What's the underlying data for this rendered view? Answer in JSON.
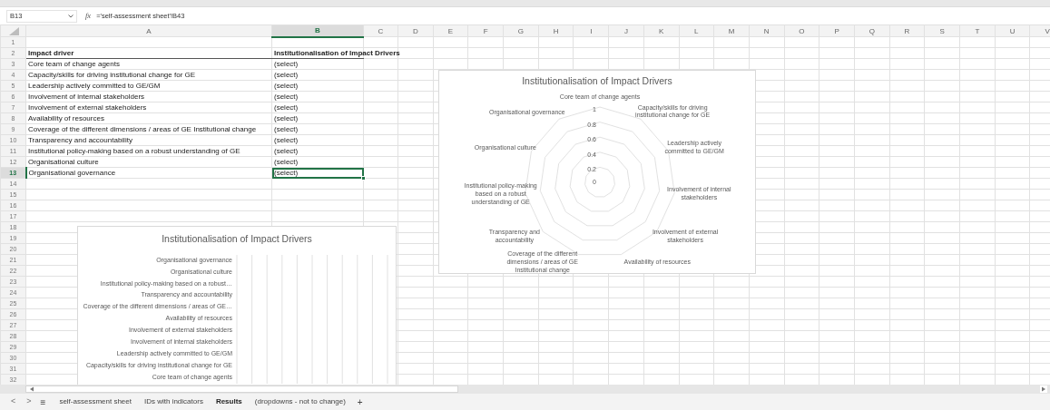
{
  "formula_bar": {
    "name_box": "B13",
    "function_label": "fx",
    "formula": "='self-assessment sheet'!B43"
  },
  "columns": [
    {
      "label": "A",
      "selected": false
    },
    {
      "label": "B",
      "selected": true
    },
    {
      "label": "C",
      "selected": false
    },
    {
      "label": "D",
      "selected": false
    },
    {
      "label": "E",
      "selected": false
    },
    {
      "label": "F",
      "selected": false
    },
    {
      "label": "G",
      "selected": false
    },
    {
      "label": "H",
      "selected": false
    },
    {
      "label": "I",
      "selected": false
    },
    {
      "label": "J",
      "selected": false
    },
    {
      "label": "K",
      "selected": false
    },
    {
      "label": "L",
      "selected": false
    },
    {
      "label": "M",
      "selected": false
    },
    {
      "label": "N",
      "selected": false
    },
    {
      "label": "O",
      "selected": false
    },
    {
      "label": "P",
      "selected": false
    },
    {
      "label": "Q",
      "selected": false
    },
    {
      "label": "R",
      "selected": false
    },
    {
      "label": "S",
      "selected": false
    },
    {
      "label": "T",
      "selected": false
    },
    {
      "label": "U",
      "selected": false
    },
    {
      "label": "V",
      "selected": false
    }
  ],
  "rows": [
    {
      "number": "1",
      "selected": false
    },
    {
      "number": "2",
      "selected": false,
      "kind": "header",
      "cells": [
        "Impact driver",
        "Institutionalisation of Impact Drivers"
      ]
    },
    {
      "number": "3",
      "selected": false,
      "kind": "data",
      "cells": [
        "Core team of change agents",
        "(select)"
      ]
    },
    {
      "number": "4",
      "selected": false,
      "kind": "data",
      "cells": [
        "Capacity/skills for driving institutional change for GE",
        "(select)"
      ]
    },
    {
      "number": "5",
      "selected": false,
      "kind": "data",
      "cells": [
        "Leadership actively committed to GE/GM",
        "(select)"
      ]
    },
    {
      "number": "6",
      "selected": false,
      "kind": "data",
      "cells": [
        "Involvement of internal stakeholders",
        "(select)"
      ]
    },
    {
      "number": "7",
      "selected": false,
      "kind": "data",
      "cells": [
        "Involvement of external stakeholders",
        "(select)"
      ]
    },
    {
      "number": "8",
      "selected": false,
      "kind": "data",
      "cells": [
        "Availability of resources",
        "(select)"
      ]
    },
    {
      "number": "9",
      "selected": false,
      "kind": "data",
      "cells": [
        "Coverage of the different dimensions / areas of GE Institutional change",
        "(select)"
      ]
    },
    {
      "number": "10",
      "selected": false,
      "kind": "data",
      "cells": [
        "Transparency and accountability",
        "(select)"
      ]
    },
    {
      "number": "11",
      "selected": false,
      "kind": "data",
      "cells": [
        "Institutional policy-making based on a robust understanding of GE",
        "(select)"
      ]
    },
    {
      "number": "12",
      "selected": false,
      "kind": "data",
      "cells": [
        "Organisational culture",
        "(select)"
      ]
    },
    {
      "number": "13",
      "selected": true,
      "kind": "data",
      "cells": [
        "Organisational governance",
        "(select)"
      ]
    },
    {
      "number": "14",
      "selected": false
    },
    {
      "number": "15",
      "selected": false
    },
    {
      "number": "16",
      "selected": false
    },
    {
      "number": "17",
      "selected": false
    },
    {
      "number": "18",
      "selected": false
    },
    {
      "number": "19",
      "selected": false
    },
    {
      "number": "20",
      "selected": false
    },
    {
      "number": "21",
      "selected": false
    },
    {
      "number": "22",
      "selected": false
    },
    {
      "number": "23",
      "selected": false
    },
    {
      "number": "24",
      "selected": false
    },
    {
      "number": "25",
      "selected": false
    },
    {
      "number": "26",
      "selected": false
    },
    {
      "number": "27",
      "selected": false
    },
    {
      "number": "28",
      "selected": false
    },
    {
      "number": "29",
      "selected": false
    },
    {
      "number": "30",
      "selected": false
    },
    {
      "number": "31",
      "selected": false
    },
    {
      "number": "32",
      "selected": false
    }
  ],
  "charts": [
    {
      "kind": "radar",
      "title": "Institutionalisation of Impact Drivers",
      "axis_labels": [
        "Core team of change agents",
        "Organisational governance",
        "Capacity/skills for driving institutional change for GE",
        "Organisational culture",
        "Leadership actively committed to GE/GM",
        "Institutional policy-making based on a robust understanding of GE",
        "Involvement of internal stakeholders",
        "Transparency and accountability",
        "Involvement of external stakeholders",
        "Coverage of the different dimensions / areas of GE Institutional change",
        "Availability of resources"
      ],
      "scale_labels": [
        "1",
        "0.8",
        "0.6",
        "0.4",
        "0.2",
        "0"
      ]
    },
    {
      "kind": "bar",
      "chart_data": {
        "type": "other",
        "title": "Institutionalisation of Impact Drivers",
        "categories": [
          "Organisational governance",
          "Organisational culture",
          "Institutional policy-making based on a robust…",
          "Transparency and accountability",
          "Coverage of the different dimensions / areas of GE…",
          "Availability of resources",
          "Involvement of external stakeholders",
          "Involvement of internal stakeholders",
          "Leadership actively committed to GE/GM",
          "Capacity/skills for driving institutional change for GE",
          "Core team of change agents"
        ]
      }
    }
  ],
  "sheet_tabs": {
    "prev": "<",
    "next": ">",
    "menu": "≡",
    "add": "+",
    "tabs": [
      {
        "label": "self-assessment sheet",
        "selected": false
      },
      {
        "label": "IDs with indicators",
        "selected": false
      },
      {
        "label": "Results",
        "selected": true
      },
      {
        "label": "(dropdowns - not to change)",
        "selected": false
      }
    ]
  }
}
